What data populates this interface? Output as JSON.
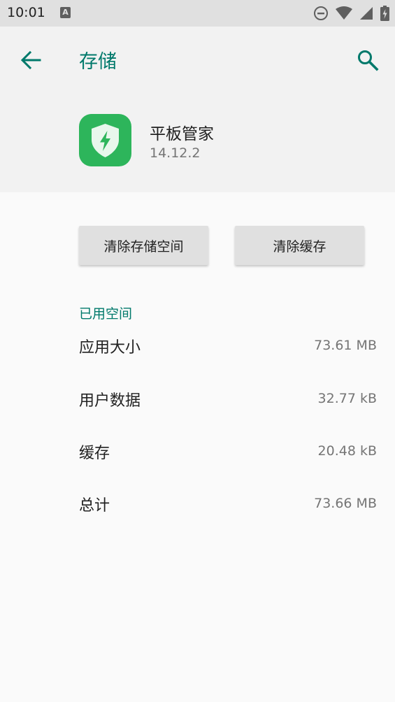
{
  "status_bar": {
    "time": "10:01",
    "notification_glyph": "A",
    "icons": [
      "do-not-disturb-icon",
      "wifi-icon",
      "signal-icon",
      "battery-charging-icon"
    ]
  },
  "header": {
    "title": "存储",
    "back_icon": "arrow-left-icon",
    "search_icon": "search-icon"
  },
  "app": {
    "name": "平板管家",
    "version": "14.12.2",
    "icon": "shield-lightning-icon",
    "icon_color": "#2db55b"
  },
  "actions": {
    "clear_storage": "清除存储空间",
    "clear_cache": "清除缓存"
  },
  "storage": {
    "section_title": "已用空间",
    "rows": [
      {
        "label": "应用大小",
        "value": "73.61 MB"
      },
      {
        "label": "用户数据",
        "value": "32.77 kB"
      },
      {
        "label": "缓存",
        "value": "20.48 kB"
      },
      {
        "label": "总计",
        "value": "73.66 MB"
      }
    ]
  },
  "colors": {
    "accent": "#00796b",
    "header_bg": "#f2f2f2",
    "status_bar_bg": "#e0e0e0"
  }
}
